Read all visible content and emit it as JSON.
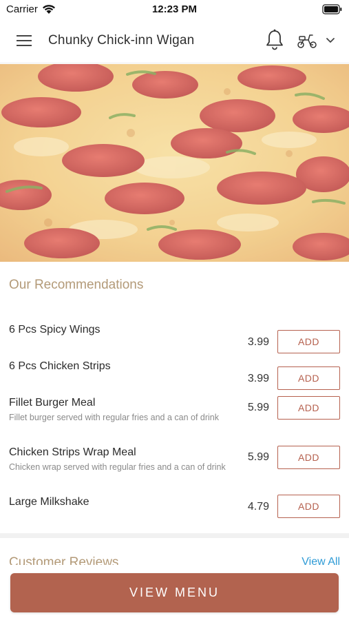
{
  "status_bar": {
    "carrier": "Carrier",
    "time": "12:23 PM"
  },
  "header": {
    "title": "Chunky Chick-inn Wigan",
    "icons": [
      "menu-icon",
      "bell-icon",
      "scooter-icon",
      "chevron-down-icon"
    ]
  },
  "recommendations": {
    "title": "Our Recommendations",
    "add_label": "ADD",
    "items": [
      {
        "name": "6 Pcs Spicy Wings",
        "description": "",
        "price": "3.99"
      },
      {
        "name": "6 Pcs Chicken Strips",
        "description": "",
        "price": "3.99"
      },
      {
        "name": "Fillet Burger Meal",
        "description": "Fillet burger served with regular fries and a can of drink",
        "price": "5.99"
      },
      {
        "name": "Chicken Strips Wrap Meal",
        "description": "Chicken wrap served with regular fries and a can of drink",
        "price": "5.99"
      },
      {
        "name": "Large Milkshake",
        "description": "",
        "price": "4.79"
      }
    ]
  },
  "reviews": {
    "title": "Customer Reviews",
    "view_all": "View All"
  },
  "footer": {
    "view_menu": "VIEW MENU"
  },
  "colors": {
    "accent": "#b5604e",
    "section_title": "#b39a78",
    "link": "#2e9bd6"
  }
}
